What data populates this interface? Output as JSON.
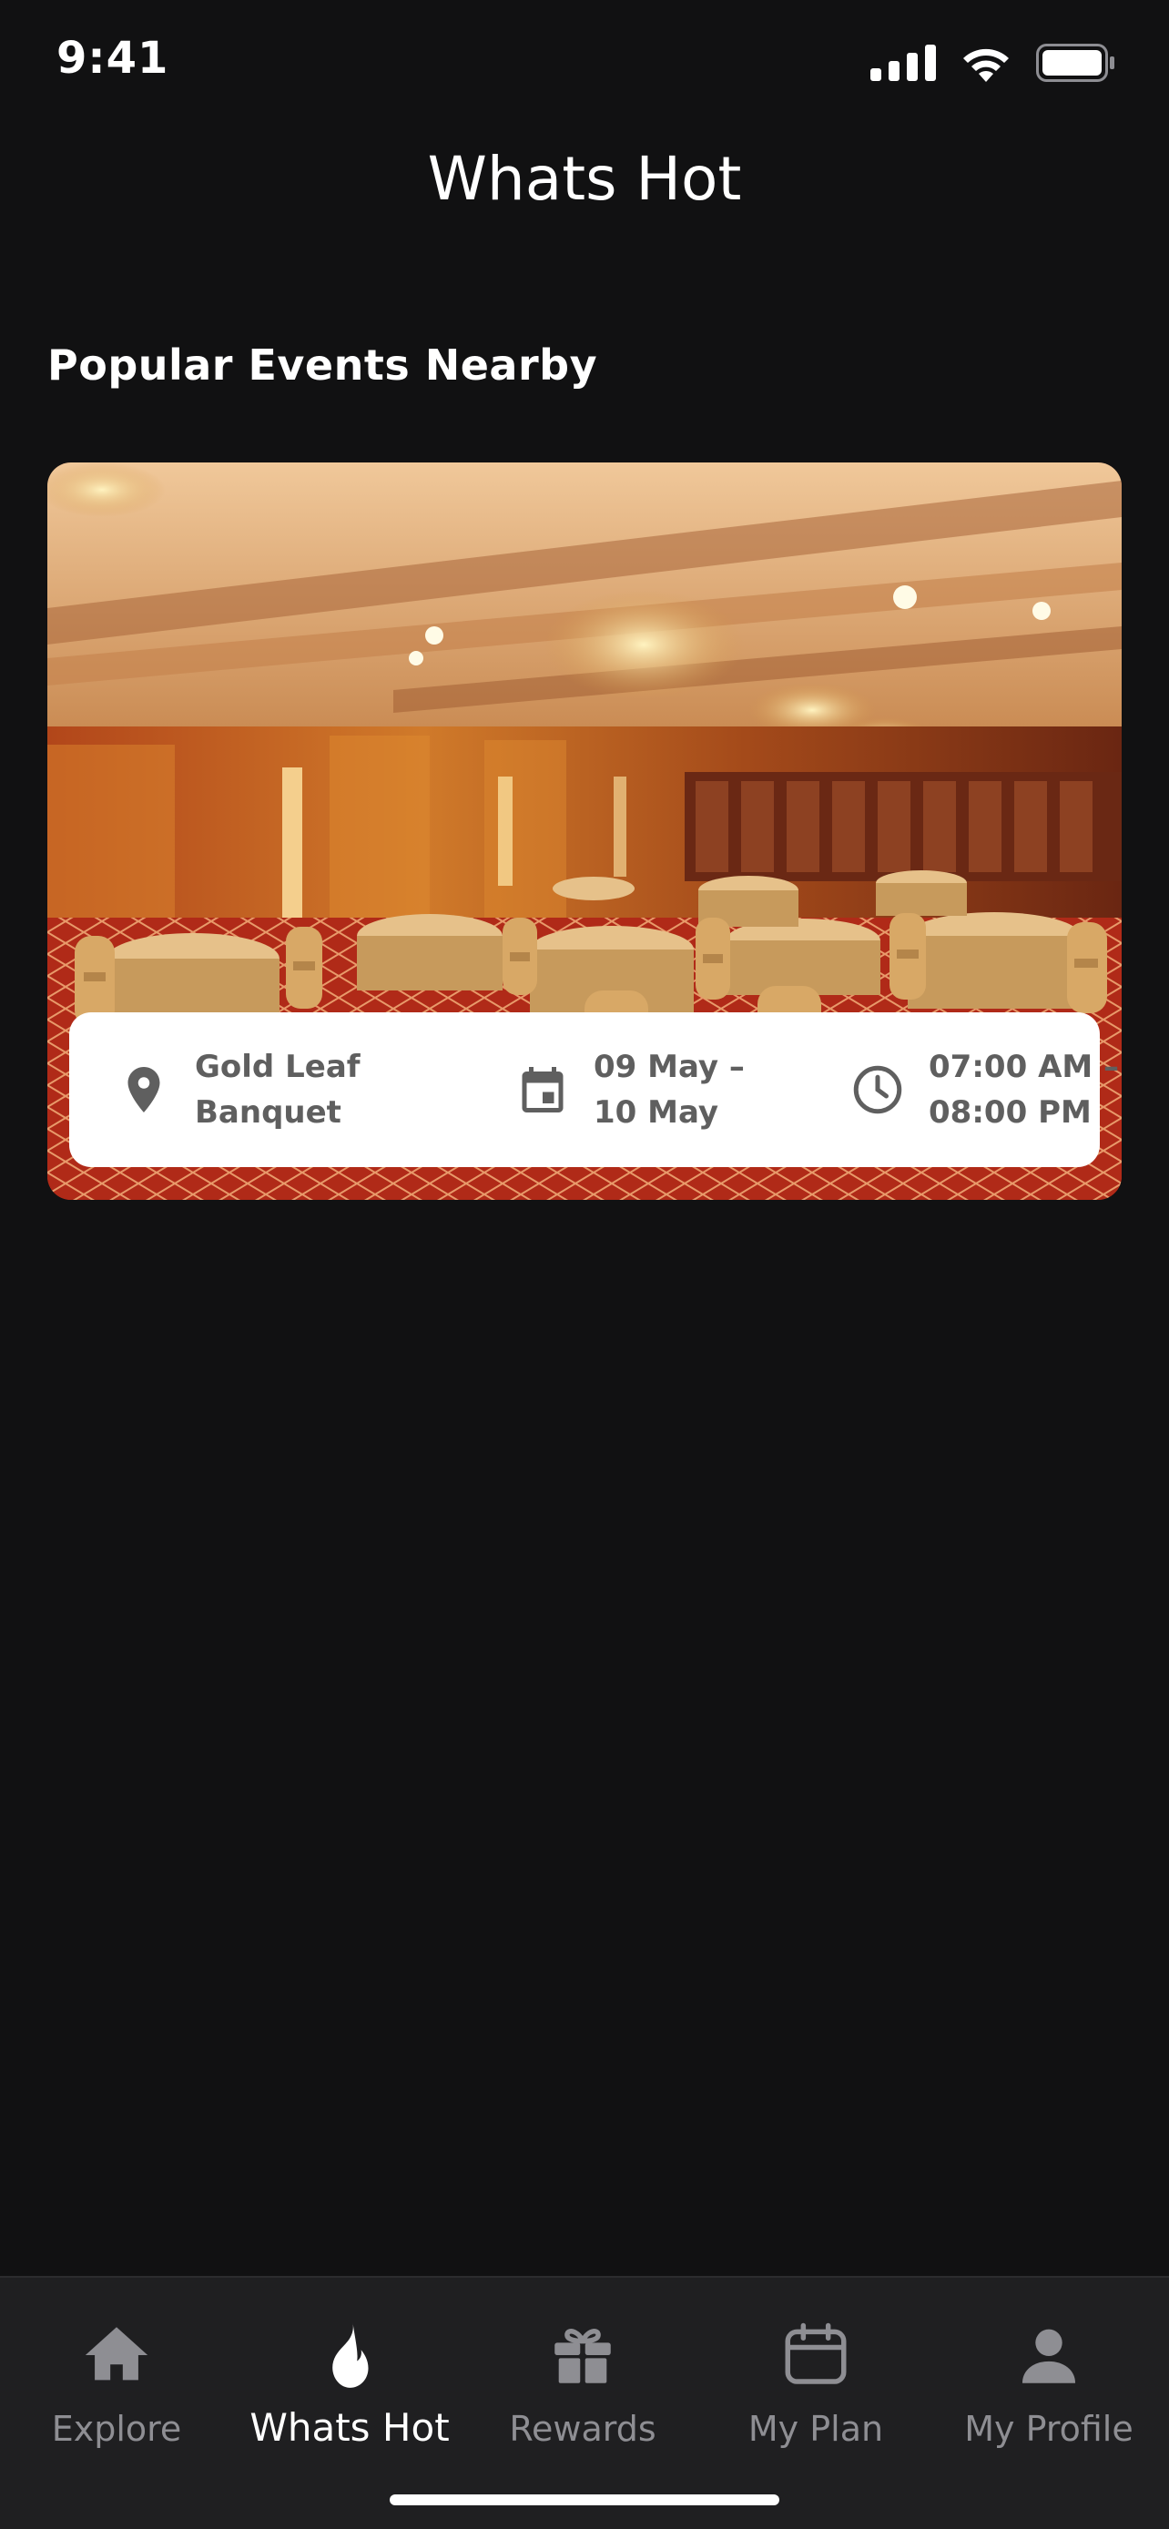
{
  "status_bar": {
    "time": "9:41",
    "icons": [
      "cellular-signal-icon",
      "wifi-icon",
      "battery-icon"
    ]
  },
  "header": {
    "title": "Whats Hot"
  },
  "section": {
    "title": "Popular Events Nearby"
  },
  "event_card": {
    "image": "banquet-hall-photo",
    "venue": {
      "icon": "location-pin-icon",
      "line1": "Gold Leaf",
      "line2": "Banquet"
    },
    "dates": {
      "icon": "calendar-icon",
      "line1": "09 May –",
      "line2": "10 May"
    },
    "times": {
      "icon": "clock-icon",
      "line1": "07:00 AM –",
      "line2": "08:00 PM"
    }
  },
  "tab_bar": {
    "active": "Whats Hot",
    "tabs": [
      {
        "label": "Explore",
        "icon": "home-icon"
      },
      {
        "label": "Whats Hot",
        "icon": "flame-icon"
      },
      {
        "label": "Rewards",
        "icon": "gift-icon"
      },
      {
        "label": "My Plan",
        "icon": "calendar-icon"
      },
      {
        "label": "My Profile",
        "icon": "person-icon"
      }
    ]
  },
  "colors": {
    "background": "#111112",
    "tab_bar": "#1f1f21",
    "tab_inactive": "#8e8e93",
    "tab_active": "#ffffff",
    "info_text": "#5f5f5f"
  }
}
